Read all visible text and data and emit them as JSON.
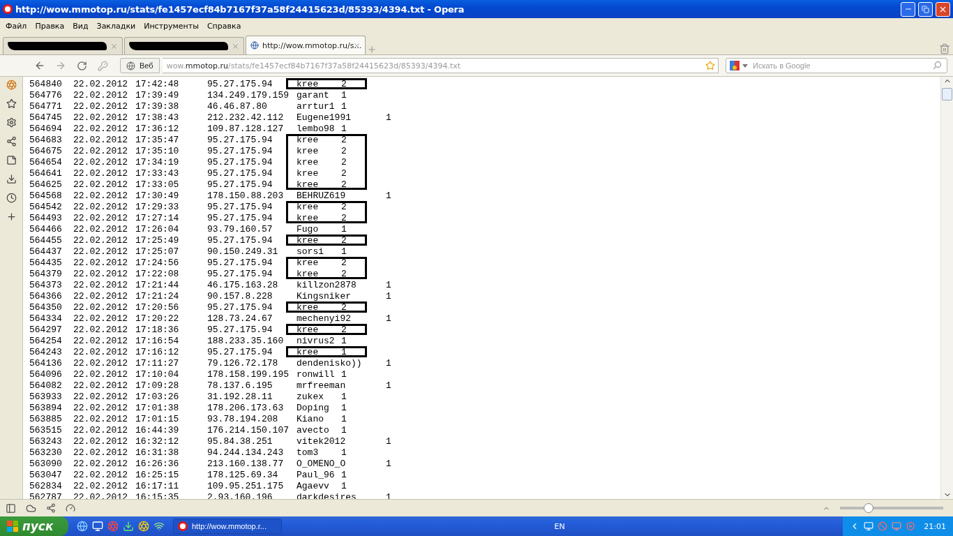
{
  "window": {
    "title": "http://wow.mmotop.ru/stats/fe1457ecf84b7167f37a58f24415623d/85393/4394.txt - Opera"
  },
  "menu": [
    "Файл",
    "Правка",
    "Вид",
    "Закладки",
    "Инструменты",
    "Справка"
  ],
  "tabs": [
    {
      "kind": "redacted",
      "selected": false
    },
    {
      "kind": "redacted",
      "selected": false
    },
    {
      "kind": "page",
      "title": "http://wow.mmotop.ru/s…",
      "selected": true
    }
  ],
  "address_bar": {
    "scope_button": "Веб",
    "url_prefix": "wow.",
    "url_domain": "mmotop.ru",
    "url_path": "/stats/fe1457ecf84b7167f37a58f24415623d/85393/4394.txt"
  },
  "search": {
    "placeholder": "Искать в Google"
  },
  "rows": [
    {
      "id": "564840",
      "date": "22.02.2012",
      "time": "17:42:48",
      "ip": "95.27.175.94",
      "user": "kree",
      "count": "2",
      "boxed": true
    },
    {
      "id": "564776",
      "date": "22.02.2012",
      "time": "17:39:49",
      "ip": "134.249.179.159",
      "user": "garant",
      "count": "1",
      "boxed": false
    },
    {
      "id": "564771",
      "date": "22.02.2012",
      "time": "17:39:38",
      "ip": "46.46.87.80",
      "user": "arrtur1",
      "count": "1",
      "boxed": false
    },
    {
      "id": "564745",
      "date": "22.02.2012",
      "time": "17:38:43",
      "ip": "212.232.42.112",
      "user": "Eugene1991",
      "count": "1",
      "boxed": false
    },
    {
      "id": "564694",
      "date": "22.02.2012",
      "time": "17:36:12",
      "ip": "109.87.128.127",
      "user": "lembo98",
      "count": "1",
      "boxed": false
    },
    {
      "id": "564683",
      "date": "22.02.2012",
      "time": "17:35:47",
      "ip": "95.27.175.94",
      "user": "kree",
      "count": "2",
      "boxed": true
    },
    {
      "id": "564675",
      "date": "22.02.2012",
      "time": "17:35:10",
      "ip": "95.27.175.94",
      "user": "kree",
      "count": "2",
      "boxed": true
    },
    {
      "id": "564654",
      "date": "22.02.2012",
      "time": "17:34:19",
      "ip": "95.27.175.94",
      "user": "kree",
      "count": "2",
      "boxed": true
    },
    {
      "id": "564641",
      "date": "22.02.2012",
      "time": "17:33:43",
      "ip": "95.27.175.94",
      "user": "kree",
      "count": "2",
      "boxed": true
    },
    {
      "id": "564625",
      "date": "22.02.2012",
      "time": "17:33:05",
      "ip": "95.27.175.94",
      "user": "kree",
      "count": "2",
      "boxed": true
    },
    {
      "id": "564568",
      "date": "22.02.2012",
      "time": "17:30:49",
      "ip": "178.150.88.203",
      "user": "BEHRUZ619",
      "count": "1",
      "boxed": false
    },
    {
      "id": "564542",
      "date": "22.02.2012",
      "time": "17:29:33",
      "ip": "95.27.175.94",
      "user": "kree",
      "count": "2",
      "boxed": true
    },
    {
      "id": "564493",
      "date": "22.02.2012",
      "time": "17:27:14",
      "ip": "95.27.175.94",
      "user": "kree",
      "count": "2",
      "boxed": true
    },
    {
      "id": "564466",
      "date": "22.02.2012",
      "time": "17:26:04",
      "ip": "93.79.160.57",
      "user": "Fugo",
      "count": "1",
      "boxed": false
    },
    {
      "id": "564455",
      "date": "22.02.2012",
      "time": "17:25:49",
      "ip": "95.27.175.94",
      "user": "kree",
      "count": "2",
      "boxed": true
    },
    {
      "id": "564437",
      "date": "22.02.2012",
      "time": "17:25:07",
      "ip": "90.150.249.31",
      "user": "sorsi",
      "count": "1",
      "boxed": false
    },
    {
      "id": "564435",
      "date": "22.02.2012",
      "time": "17:24:56",
      "ip": "95.27.175.94",
      "user": "kree",
      "count": "2",
      "boxed": true
    },
    {
      "id": "564379",
      "date": "22.02.2012",
      "time": "17:22:08",
      "ip": "95.27.175.94",
      "user": "kree",
      "count": "2",
      "boxed": true
    },
    {
      "id": "564373",
      "date": "22.02.2012",
      "time": "17:21:44",
      "ip": "46.175.163.28",
      "user": "killzon2878",
      "count": "1",
      "boxed": false
    },
    {
      "id": "564366",
      "date": "22.02.2012",
      "time": "17:21:24",
      "ip": "90.157.8.228",
      "user": "Kingsniker",
      "count": "1",
      "boxed": false
    },
    {
      "id": "564350",
      "date": "22.02.2012",
      "time": "17:20:56",
      "ip": "95.27.175.94",
      "user": "kree",
      "count": "2",
      "boxed": true
    },
    {
      "id": "564334",
      "date": "22.02.2012",
      "time": "17:20:22",
      "ip": "128.73.24.67",
      "user": "mechenyi92",
      "count": "1",
      "boxed": false
    },
    {
      "id": "564297",
      "date": "22.02.2012",
      "time": "17:18:36",
      "ip": "95.27.175.94",
      "user": "kree",
      "count": "2",
      "boxed": true
    },
    {
      "id": "564254",
      "date": "22.02.2012",
      "time": "17:16:54",
      "ip": "188.233.35.160",
      "user": "nivrus2",
      "count": "1",
      "boxed": false
    },
    {
      "id": "564243",
      "date": "22.02.2012",
      "time": "17:16:12",
      "ip": "95.27.175.94",
      "user": "kree",
      "count": "1",
      "boxed": true
    },
    {
      "id": "564136",
      "date": "22.02.2012",
      "time": "17:11:27",
      "ip": "79.126.72.178",
      "user": "dendenisko))",
      "count": "1",
      "boxed": false
    },
    {
      "id": "564096",
      "date": "22.02.2012",
      "time": "17:10:04",
      "ip": "178.158.199.195",
      "user": "ronwill",
      "count": "1",
      "boxed": false
    },
    {
      "id": "564082",
      "date": "22.02.2012",
      "time": "17:09:28",
      "ip": "78.137.6.195",
      "user": "mrfreeman",
      "count": "1",
      "boxed": false
    },
    {
      "id": "563933",
      "date": "22.02.2012",
      "time": "17:03:26",
      "ip": "31.192.28.11",
      "user": "zukex",
      "count": "1",
      "boxed": false
    },
    {
      "id": "563894",
      "date": "22.02.2012",
      "time": "17:01:38",
      "ip": "178.206.173.63",
      "user": "Doping",
      "count": "1",
      "boxed": false
    },
    {
      "id": "563885",
      "date": "22.02.2012",
      "time": "17:01:15",
      "ip": "93.78.194.208",
      "user": "Kiano",
      "count": "1",
      "boxed": false
    },
    {
      "id": "563515",
      "date": "22.02.2012",
      "time": "16:44:39",
      "ip": "176.214.150.107",
      "user": "avecto",
      "count": "1",
      "boxed": false
    },
    {
      "id": "563243",
      "date": "22.02.2012",
      "time": "16:32:12",
      "ip": "95.84.38.251",
      "user": "vitek2012",
      "count": "1",
      "boxed": false
    },
    {
      "id": "563230",
      "date": "22.02.2012",
      "time": "16:31:38",
      "ip": "94.244.134.243",
      "user": "tom3",
      "count": "1",
      "boxed": false
    },
    {
      "id": "563090",
      "date": "22.02.2012",
      "time": "16:26:36",
      "ip": "213.160.138.77",
      "user": "O_OMENO_O",
      "count": "1",
      "boxed": false
    },
    {
      "id": "563047",
      "date": "22.02.2012",
      "time": "16:25:15",
      "ip": "178.125.69.34",
      "user": "Paul_96",
      "count": "1",
      "boxed": false
    },
    {
      "id": "562834",
      "date": "22.02.2012",
      "time": "16:17:11",
      "ip": "109.95.251.175",
      "user": "Agaevv",
      "count": "1",
      "boxed": false
    },
    {
      "id": "562787",
      "date": "22.02.2012",
      "time": "16:15:35",
      "ip": "2.93.160.196",
      "user": "darkdesires",
      "count": "1",
      "boxed": false
    }
  ],
  "status_bar": {
    "zoom": {
      "level": 0.28
    }
  },
  "taskbar": {
    "start": "пуск",
    "window_button": "http://wow.mmotop.r...",
    "language": "EN",
    "clock": "21:01"
  }
}
